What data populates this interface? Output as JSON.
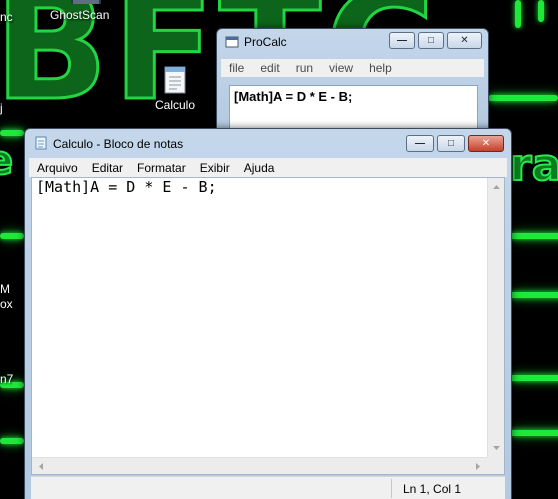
{
  "desktop": {
    "icons": [
      {
        "label": "GhostScan",
        "icon": "ghostscan-icon"
      },
      {
        "label": "Calculo",
        "icon": "text-file-icon"
      }
    ],
    "partial_labels": [
      "nc",
      "j",
      "M",
      "ox",
      "n7"
    ]
  },
  "procalc": {
    "title": "ProCalc",
    "menu": [
      "file",
      "edit",
      "run",
      "view",
      "help"
    ],
    "editor_text": "[Math]A = D * E - B;"
  },
  "notepad": {
    "title": "Calculo - Bloco de notas",
    "menu": [
      "Arquivo",
      "Editar",
      "Formatar",
      "Exibir",
      "Ajuda"
    ],
    "text": "[Math]A = D * E - B;",
    "status": "Ln 1, Col 1"
  },
  "caption_buttons": {
    "minimize": "minimize-button",
    "maximize": "maximize-button",
    "close": "close-button"
  }
}
